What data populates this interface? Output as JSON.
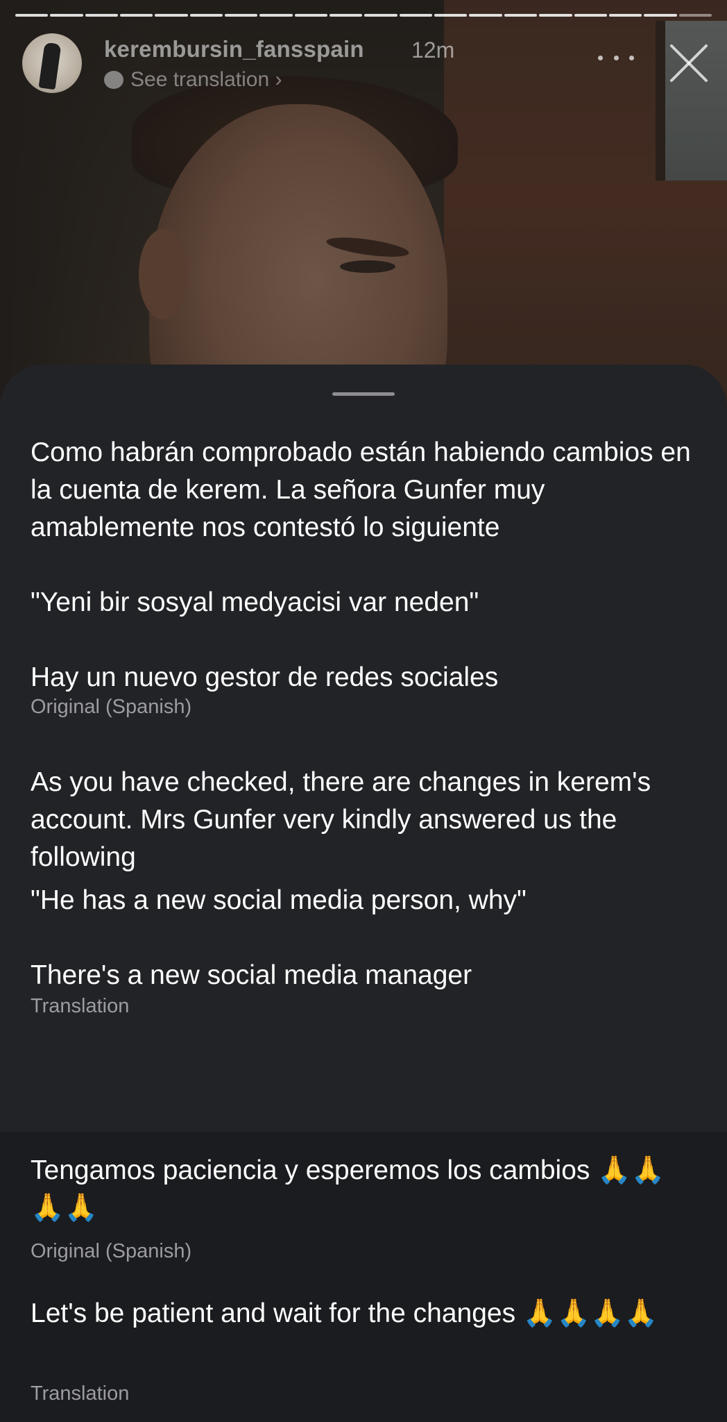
{
  "story": {
    "progress_segments": 20,
    "progress_completed": 19,
    "username": "kerembursin_fansspain",
    "time": "12m",
    "see_translation": "See translation ›"
  },
  "sheet": {
    "original_text_1": "Como habrán comprobado están habiendo cambios en la cuenta de kerem. La señora Gunfer muy amablemente nos contestó lo siguiente",
    "original_text_2": "\"Yeni bir sosyal medyacisi var neden\"",
    "original_text_3": "Hay un nuevo gestor de redes sociales",
    "original_label_1": "Original (Spanish)",
    "translation_text_1": "As you have checked, there are changes in kerem's account. Mrs Gunfer very kindly answered us the following",
    "translation_text_2": "\"He has a new social media person, why\"",
    "translation_text_3": "There's a new social media manager",
    "translation_label_1": "Translation",
    "original_text_4": "Tengamos paciencia y esperemos los cambios 🙏🙏🙏🙏",
    "original_label_2": "Original (Spanish)",
    "translation_text_4": "Let's be patient and wait for the changes 🙏🙏🙏🙏",
    "translation_label_2": "Translation"
  },
  "icons": {
    "more": "more-icon",
    "close": "close-icon",
    "translate": "translate-bubble-icon"
  },
  "colors": {
    "sheet_bg": "#222327",
    "band_bg": "#1b1c1f",
    "caption": "#9c9ca1"
  }
}
